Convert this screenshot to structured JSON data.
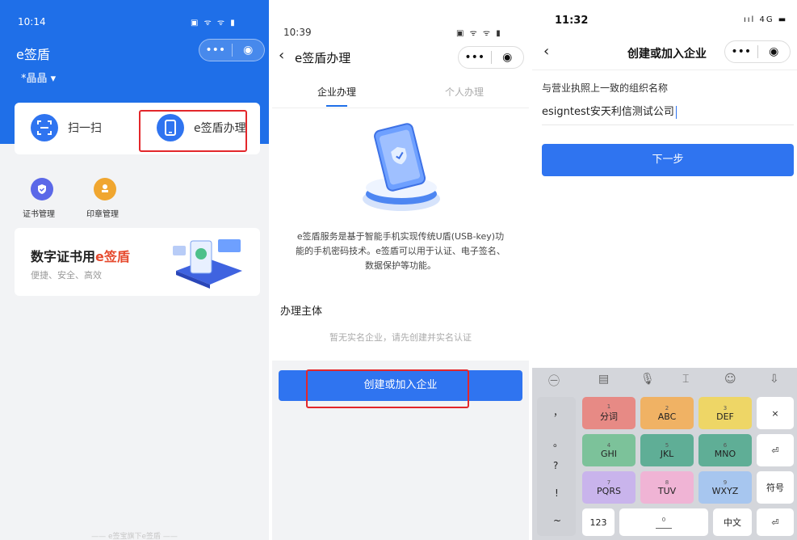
{
  "screen1": {
    "status_time": "10:14",
    "status_icons": "▣ ᯤ ᯤ ▮",
    "title": "e签盾",
    "org": "*晶晶 ▾",
    "scan_label": "扫一扫",
    "apply_label": "e签盾办理",
    "cert_label": "证书管理",
    "seal_label": "印章管理",
    "promo_title_prefix": "数字证书用",
    "promo_title_accent": "e签盾",
    "promo_subtitle": "便捷、安全、高效",
    "footer": "—— e签宝旗下e签盾 ——",
    "capsule_more": "•••",
    "capsule_close": "◉"
  },
  "screen2": {
    "status_time": "10:39",
    "status_icons": "▣ ᯤ ᯤ ▮",
    "title": "e签盾办理",
    "back": "‹",
    "tab_company": "企业办理",
    "tab_personal": "个人办理",
    "description": "e签盾服务是基于智能手机实现传统U盾(USB-key)功能的手机密码技术。e签盾可以用于认证、电子签名、数据保护等功能。",
    "section_title": "办理主体",
    "empty_text": "暂无实名企业，请先创建并实名认证",
    "create_button": "创建或加入企业",
    "capsule_more": "•••",
    "capsule_close": "◉"
  },
  "screen3": {
    "status_time": "11:32",
    "status_icons": "ııl 4G ▬",
    "title": "创建或加入企业",
    "back": "‹",
    "field_label": "与营业执照上一致的组织名称",
    "field_value": "esigntest安天利信测试公司",
    "next_button": "下一步",
    "capsule_more": "•••",
    "capsule_close": "◉",
    "keyboard": {
      "tools": [
        "㊀",
        "▤",
        "🎙",
        "⌶",
        "☺",
        "⇩"
      ],
      "punct": [
        "，",
        "。",
        "?",
        "!",
        "~"
      ],
      "keys": {
        "k1_num": "1",
        "k1_label": "分词",
        "k2_num": "2",
        "k2_label": "ABC",
        "k3_num": "3",
        "k3_label": "DEF",
        "k4_num": "4",
        "k4_label": "GHI",
        "k5_num": "5",
        "k5_label": "JKL",
        "k6_num": "6",
        "k6_label": "MNO",
        "k7_num": "7",
        "k7_label": "PQRS",
        "k8_num": "8",
        "k8_label": "TUV",
        "k9_num": "9",
        "k9_label": "WXYZ",
        "delete": "×",
        "enter1": "⏎",
        "symbols": "符号",
        "num123": "123",
        "space_num": "0",
        "lang": "中文",
        "enter2": "⏎"
      }
    }
  },
  "colors": {
    "brand_blue": "#1f6fe8",
    "button_blue": "#2f74f0",
    "highlight_red": "#e3272b",
    "accent_orange": "#e64a2e"
  }
}
